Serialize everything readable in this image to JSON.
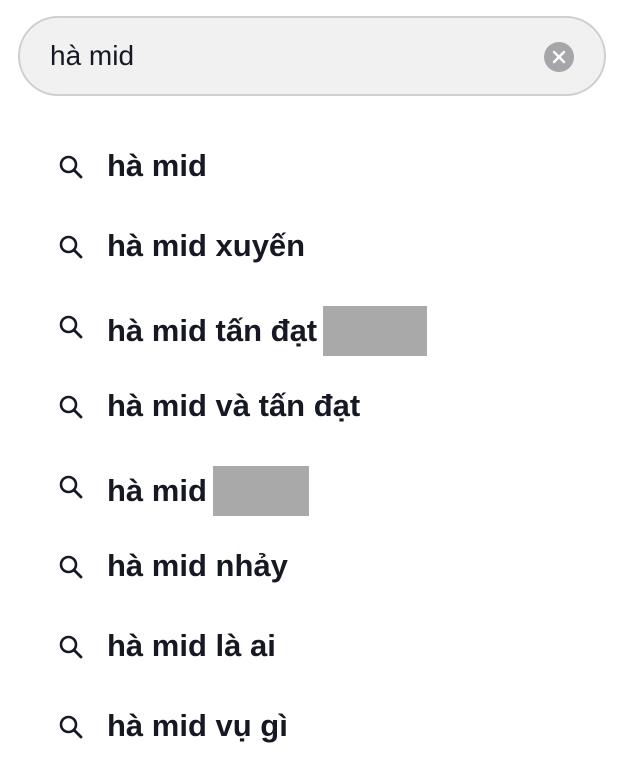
{
  "search": {
    "value": "hà mid",
    "clear_icon": "clear-circle-x-icon"
  },
  "colors": {
    "search_bg": "#f1f1f2",
    "search_border": "#cfcfd1",
    "clear_bg": "#a6a6aa",
    "text": "#161823",
    "redaction": "#a9a9a9"
  },
  "suggestions": [
    {
      "label": "hà mid",
      "icon": "search-icon"
    },
    {
      "label": "hà mid xuyến",
      "icon": "search-icon"
    },
    {
      "label": "hà mid tấn đạt",
      "icon": "search-icon",
      "redacted": true
    },
    {
      "label": "hà mid và tấn đạt",
      "icon": "search-icon"
    },
    {
      "label": "hà mid",
      "icon": "search-icon",
      "redacted": true
    },
    {
      "label": "hà mid nhảy",
      "icon": "search-icon"
    },
    {
      "label": "hà mid là ai",
      "icon": "search-icon"
    },
    {
      "label": "hà mid vụ gì",
      "icon": "search-icon"
    }
  ]
}
